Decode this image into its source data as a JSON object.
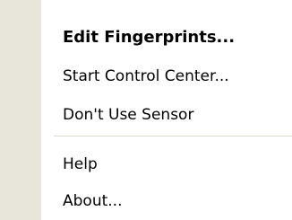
{
  "menu": {
    "items": [
      {
        "label": "Edit Fingerprints..."
      },
      {
        "label": "Start Control Center..."
      },
      {
        "label": "Don't Use Sensor"
      },
      {
        "label": "Help"
      },
      {
        "label": "About..."
      }
    ]
  },
  "colors": {
    "gutter": "#e8e6db",
    "background": "#ffffff",
    "separator": "#dedbd0",
    "text": "#000000"
  }
}
